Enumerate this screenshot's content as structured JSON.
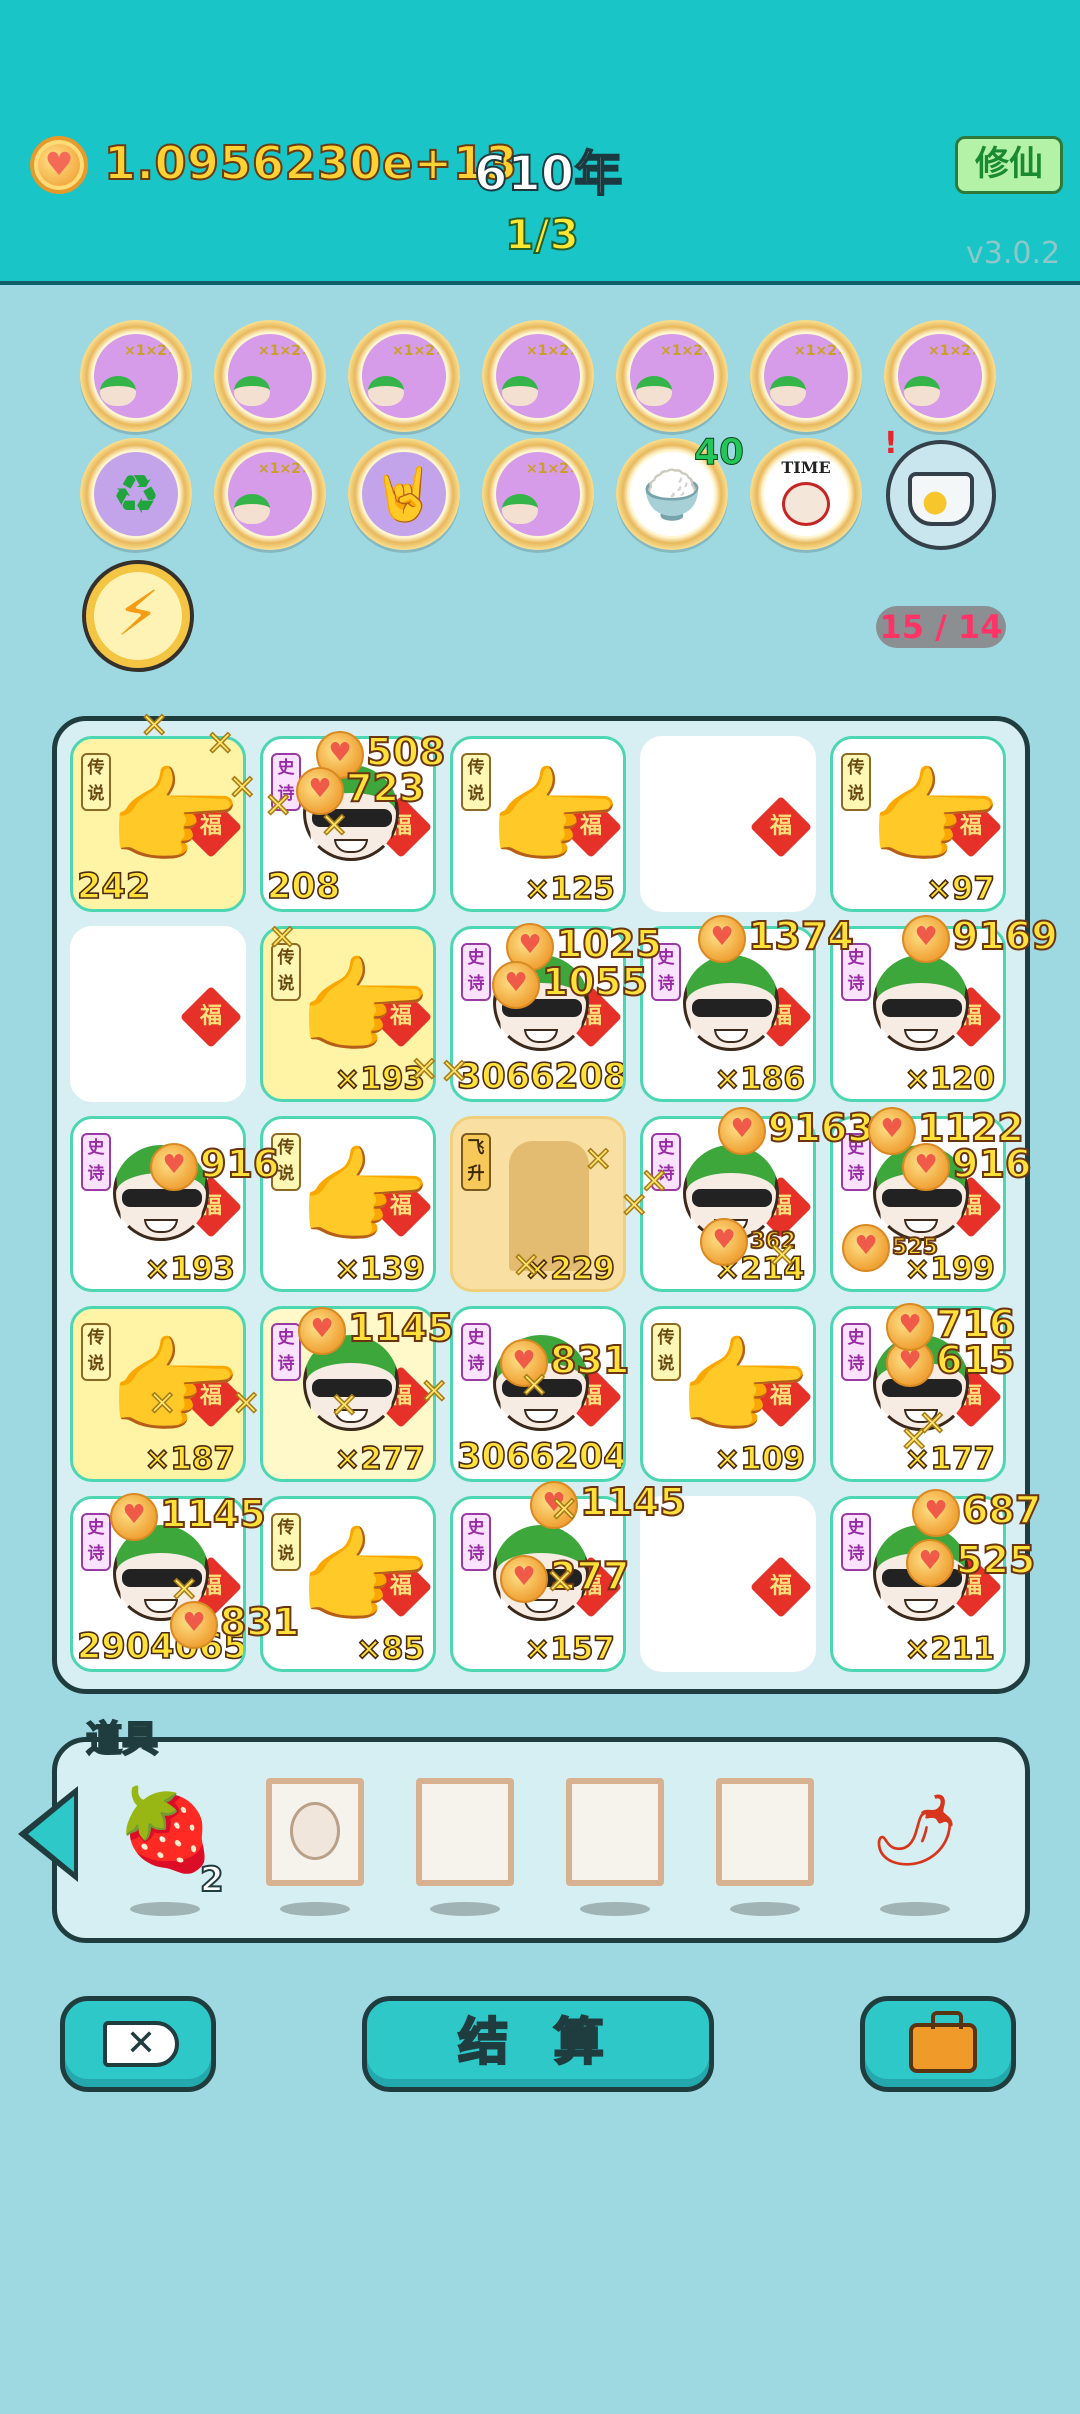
{
  "header": {
    "balance": "1.0956230e+13",
    "years": "610年",
    "cultivate_button": "修仙",
    "page_indicator": "1/3",
    "version": "v3.0.2"
  },
  "skills": {
    "orb_multiplier_text": "×1×2×1×2×2",
    "rice_bowl_badge": "40",
    "time_magazine_label": "TIME",
    "slot_count": "15 / 14"
  },
  "board": {
    "tags": {
      "legend": "传说",
      "epic": "史诗",
      "ascend": "飞升"
    },
    "fu_label": "福",
    "cells": [
      {
        "kind": "hand",
        "tag": "legend",
        "count": "242"
      },
      {
        "kind": "head",
        "tag": "epic",
        "count": "208"
      },
      {
        "kind": "hand",
        "tag": "legend",
        "count": "×125"
      },
      {
        "kind": "empty",
        "tag": "",
        "count": ""
      },
      {
        "kind": "hand",
        "tag": "legend",
        "count": "×97"
      },
      {
        "kind": "empty",
        "tag": "",
        "count": ""
      },
      {
        "kind": "hand",
        "tag": "legend",
        "count": "×193"
      },
      {
        "kind": "head",
        "tag": "epic",
        "count": "3066208"
      },
      {
        "kind": "head",
        "tag": "epic",
        "count": "×186"
      },
      {
        "kind": "head",
        "tag": "epic",
        "count": "×120"
      },
      {
        "kind": "head",
        "tag": "epic",
        "count": "×193"
      },
      {
        "kind": "hand",
        "tag": "legend",
        "count": "×139"
      },
      {
        "kind": "wall",
        "tag": "ascend",
        "count": "×229"
      },
      {
        "kind": "head",
        "tag": "epic",
        "count": "×214"
      },
      {
        "kind": "head",
        "tag": "epic",
        "count": "×199"
      },
      {
        "kind": "hand",
        "tag": "legend",
        "count": "×187"
      },
      {
        "kind": "head",
        "tag": "epic",
        "count": "×277"
      },
      {
        "kind": "head",
        "tag": "epic",
        "count": "3066204"
      },
      {
        "kind": "hand",
        "tag": "legend",
        "count": "×109"
      },
      {
        "kind": "head",
        "tag": "epic",
        "count": "×177"
      },
      {
        "kind": "head",
        "tag": "epic",
        "count": "2904065"
      },
      {
        "kind": "hand",
        "tag": "legend",
        "count": "×85"
      },
      {
        "kind": "head",
        "tag": "epic",
        "count": "×157"
      },
      {
        "kind": "empty",
        "tag": "",
        "count": ""
      },
      {
        "kind": "head",
        "tag": "epic",
        "count": "×211"
      }
    ],
    "popups": [
      "508",
      "723",
      "1025",
      "1055",
      "1374",
      "9169",
      "916",
      "9163",
      "1122",
      "916",
      "1145",
      "831",
      "615",
      "716",
      "1145",
      "831",
      "1145",
      "277",
      "687",
      "525",
      "525",
      "362"
    ]
  },
  "items": {
    "title": "道具",
    "strawberry_qty": "2"
  },
  "actions": {
    "settle_label": "结 算"
  },
  "colors": {
    "header_bg": "#19c5c6",
    "page_bg": "#9ed9e2",
    "board_border": "#1f3c3e",
    "gold_text": "#ffd233"
  }
}
